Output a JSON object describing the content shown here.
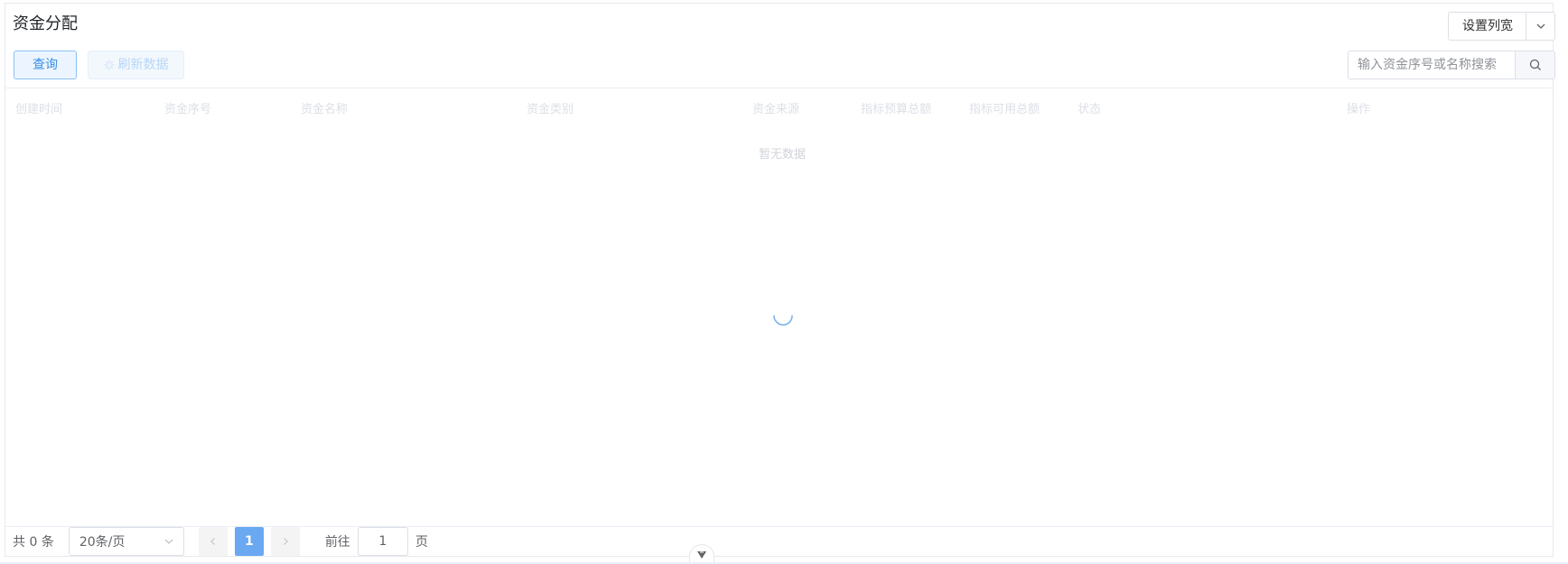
{
  "header": {
    "title": "资金分配",
    "column_width_button": "设置列宽"
  },
  "toolbar": {
    "query_label": "查询",
    "refresh_label": "刷新数据"
  },
  "search": {
    "placeholder": "输入资金序号或名称搜索",
    "value": ""
  },
  "table": {
    "columns": [
      "创建时间",
      "资金序号",
      "资金名称",
      "资金类别",
      "资金来源",
      "指标预算总额",
      "指标可用总额",
      "状态",
      "操作"
    ],
    "empty_text": "暂无数据",
    "loading": true
  },
  "pagination": {
    "total_text": "共 0 条",
    "page_size": "20条/页",
    "current_page": "1",
    "goto_label": "前往",
    "goto_value": "1",
    "page_unit": "页"
  },
  "colors": {
    "accent": "#409eff",
    "active_page": "#6aa8f2"
  }
}
